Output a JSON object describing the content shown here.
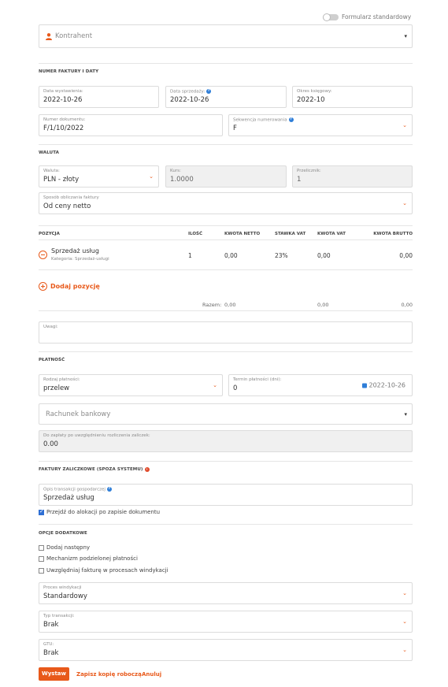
{
  "header": {
    "toggle_label": "Formularz standardowy"
  },
  "contractor": {
    "placeholder": "Kontrahent"
  },
  "sections": {
    "invoice_dates": "NUMER FAKTURY I DATY",
    "currency": "WALUTA",
    "payment": "PŁATNOŚĆ",
    "advance_invoices": "FAKTURY ZALICZKOWE (SPOZA SYSTEMU)",
    "extra_options": "OPCJE DODATKOWE"
  },
  "dates": {
    "issue_label": "Data wystawienia:",
    "issue_value": "2022-10-26",
    "sale_label": "Data sprzedaży:",
    "sale_value": "2022-10-26",
    "period_label": "Okres księgowy:",
    "period_value": "2022-10",
    "docnum_label": "Numer dokumentu:",
    "docnum_value": "F/1/10/2022",
    "sequence_label": "Sekwencja numerowania",
    "sequence_value": "F"
  },
  "currency": {
    "currency_label": "Waluta:",
    "currency_value": "PLN - złoty",
    "rate_label": "Kurs:",
    "rate_value": "1.0000",
    "multiplier_label": "Przelicznik:",
    "multiplier_value": "1",
    "calc_label": "Sposób obliczania faktury",
    "calc_value": "Od ceny netto"
  },
  "items_table": {
    "headers": [
      "POZYCJA",
      "ILOŚĆ",
      "KWOTA NETTO",
      "STAWKA VAT",
      "KWOTA VAT",
      "KWOTA BRUTTO"
    ],
    "row": {
      "name": "Sprzedaż usług",
      "category": "Kategoria: Sprzedaż-usługi",
      "qty": "1",
      "net": "0,00",
      "vat_rate": "23%",
      "vat": "0,00",
      "gross": "0,00"
    },
    "add_label": "Dodaj pozycję",
    "total_label": "Razem:",
    "total_net": "0,00",
    "total_vat": "0,00",
    "total_gross": "0,00"
  },
  "notes": {
    "label": "Uwagi:"
  },
  "payment": {
    "type_label": "Rodzaj płatności:",
    "type_value": "przelew",
    "term_label": "Termin płatności (dni):",
    "term_value": "0",
    "due_date": "2022-10-26",
    "bank_placeholder": "Rachunek bankowy",
    "due_amount_label": "Do zapłaty po uwzględnieniu rozliczenia zaliczek:",
    "due_amount_value": "0.00"
  },
  "advance": {
    "desc_label": "Opis transakcji gospodarczej",
    "desc_value": "Sprzedaż usług",
    "goto_alloc": "Przejdź do alokacji po zapisie dokumentu"
  },
  "extras": {
    "add_next": "Dodaj następny",
    "split_payment": "Mechanizm podzielonej płatności",
    "debt_collection": "Uwzględniaj fakturę w procesach windykacji",
    "process_label": "Proces windykacji",
    "process_value": "Standardowy",
    "transaction_label": "Typ transakcji:",
    "transaction_value": "Brak",
    "gtu_label": "GTU:",
    "gtu_value": "Brak"
  },
  "actions": {
    "issue": "Wystaw",
    "save_draft": "Zapisz kopię roboczą",
    "cancel": "Anuluj"
  },
  "colors": {
    "accent": "#e8591a",
    "info": "#2f7ed8"
  }
}
